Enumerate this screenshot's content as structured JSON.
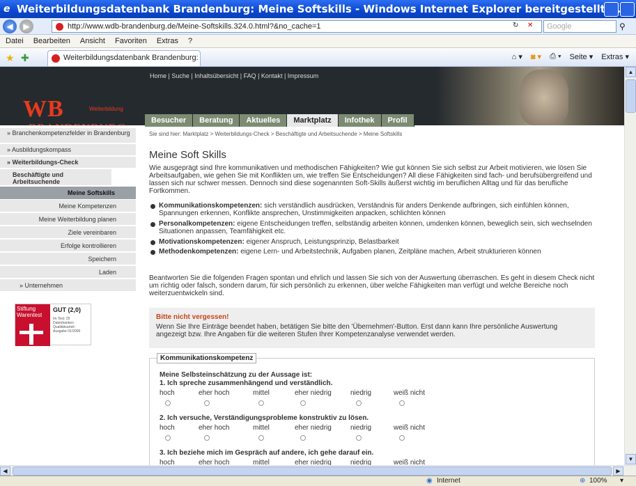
{
  "window": {
    "title": "Weiterbildungsdatenbank Brandenburg: Meine Softskills - Windows Internet Explorer bereitgestellt ..."
  },
  "address": {
    "url": "http://www.wdb-brandenburg.de/Meine-Softskills.324.0.html?&no_cache=1",
    "search_placeholder": "Google"
  },
  "menu": [
    "Datei",
    "Bearbeiten",
    "Ansicht",
    "Favoriten",
    "Extras",
    "?"
  ],
  "tab": {
    "label": "Weiterbildungsdatenbank Brandenburg: Mein..."
  },
  "tools": {
    "seite": "Seite ▾",
    "extras": "Extras ▾"
  },
  "banner": {
    "logo_big": "WB",
    "logo_small": "Weiterbildung",
    "logo_brand": "BRANDENBURG",
    "toplinks": "Home | Suche | Inhaltsübersicht | FAQ | Kontakt | Impressum"
  },
  "mainnav": [
    "Besucher",
    "Beratung",
    "Aktuelles",
    "Marktplatz",
    "Infothek",
    "Profil"
  ],
  "sidebar": [
    {
      "label": "» Branchenkompetenzfelder in Brandenburg"
    },
    {
      "label": "» Ausbildungskompass"
    },
    {
      "label": "» Weiterbildungs-Check"
    },
    {
      "label": "Beschäftigte und Arbeitsuchende"
    },
    {
      "label": "Meine Softskills"
    },
    {
      "label": "Meine Kompetenzen"
    },
    {
      "label": "Meine Weiterbildung planen"
    },
    {
      "label": "Ziele vereinbaren"
    },
    {
      "label": "Erfolge kontrollieren"
    },
    {
      "label": "Speichern"
    },
    {
      "label": "Laden"
    },
    {
      "label": "» Unternehmen"
    }
  ],
  "quality": {
    "brand": "Stiftung Warentest",
    "note": "GUT (2,0)",
    "sub": "Im Test: 25 Datenbanken · Qualitätsurteil · Ausgabe 01/2009"
  },
  "content": {
    "breadcrumb": "Sie sind hier: Marktplatz > Weiterbildungs-Check > Beschäftigte und Arbeitsuchende > Meine Softskills",
    "title": "Meine Soft Skills",
    "intro": "Wie ausgeprägt sind Ihre kommunikativen und methodischen Fähigkeiten? Wie gut können Sie sich selbst zur Arbeit motivieren, wie lösen Sie Arbeitsaufgaben, wie gehen Sie mit Konflikten um, wie treffen Sie Entscheidungen? All diese Fähigkeiten sind fach- und berufsübergreifend und lassen sich nur schwer messen. Dennoch sind diese sogenannten Soft-Skills äußerst wichtig im beruflichen Alltag und für das berufliche Fortkommen.",
    "bullets": [
      {
        "term": "Kommunikationskompetenzen:",
        "text": " sich verständlich ausdrücken, Verständnis für anders Denkende aufbringen, sich einfühlen können, Spannungen erkennen, Konflikte ansprechen, Unstimmigkeiten anpacken, schlichten können"
      },
      {
        "term": "Personalkompetenzen:",
        "text": " eigene Entscheidungen treffen, selbständig arbeiten können, umdenken können, beweglich sein, sich wechselnden Situationen anpassen, Teamfähigkeit etc."
      },
      {
        "term": "Motivationskompetenzen:",
        "text": " eigener Anspruch, Leistungsprinzip, Belastbarkeit"
      },
      {
        "term": "Methodenkompetenzen:",
        "text": " eigene Lern- und Arbeitstechnik, Aufgaben planen, Zeitpläne machen, Arbeit strukturieren können"
      }
    ],
    "answer_hint": "Beantworten Sie die folgenden Fragen spontan und ehrlich und lassen Sie sich von der Auswertung überraschen. Es geht in diesem Check nicht um richtig oder falsch, sondern darum, für sich persönlich zu erkennen, über welche Fähigkeiten man verfügt und welche Bereiche noch weiterzuentwickeln sind.",
    "notice_title": "Bitte nicht vergessen!",
    "notice_text": "Wenn Sie Ihre Einträge beendet haben, betätigen Sie bitte den 'Übernehmen'-Button. Erst dann kann Ihre persönliche Auswertung angezeigt bzw. Ihre Angaben für die weiteren Stufen Ihrer Kompetenzanalyse verwendet werden.",
    "fieldset_legend": "Kommunikationskompetenz",
    "self_assessment": "Meine Selbsteinschätzung zu der Aussage ist:",
    "options": [
      "hoch",
      "eher hoch",
      "mittel",
      "eher niedrig",
      "niedrig",
      "weiß nicht"
    ],
    "questions": [
      "1. Ich spreche zusammenhängend und verständlich.",
      "2. Ich versuche, Verständigungsprobleme konstruktiv zu lösen.",
      "3. Ich beziehe mich im Gespräch auf andere, ich gehe darauf ein."
    ]
  },
  "status": {
    "zone": "Internet",
    "zoom": "100%"
  }
}
